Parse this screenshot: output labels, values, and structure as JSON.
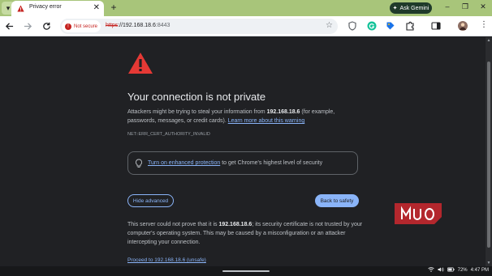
{
  "tabs": [
    {
      "title": "Privacy error",
      "favicon": "warning-triangle-icon"
    }
  ],
  "toolbar": {
    "ask_gemini_label": "Ask Gemini",
    "security_chip_label": "Not secure",
    "url_scheme": "https",
    "url_rest": "://192.168.18.6",
    "url_port": ":8443"
  },
  "page": {
    "heading": "Your connection is not private",
    "intro_before": "Attackers might be trying to steal your information from ",
    "intro_host": "192.168.18.6",
    "intro_after": " (for example, passwords, messages, or credit cards). ",
    "learn_more": "Learn more about this warning",
    "error_code": "NET::ERR_CERT_AUTHORITY_INVALID",
    "enhanced_link": "Turn on enhanced protection",
    "enhanced_rest": " to get Chrome's highest level of security",
    "hide_advanced": "Hide advanced",
    "back_to_safety": "Back to safety",
    "details_before": "This server could not prove that it is ",
    "details_host": "192.168.18.6",
    "details_after": "; its security certificate is not trusted by your computer's operating system. This may be caused by a misconfiguration or an attacker intercepting your connection.",
    "proceed_link": "Proceed to 192.168.18.6 (unsafe)"
  },
  "watermark": "MUO",
  "taskbar": {
    "battery": "72%",
    "time": "4:47 PM"
  },
  "colors": {
    "tabstrip": "#a8c57a",
    "page_bg": "#202124",
    "link": "#8ab4f8",
    "danger": "#c5221f",
    "watermark": "#b3272d"
  }
}
